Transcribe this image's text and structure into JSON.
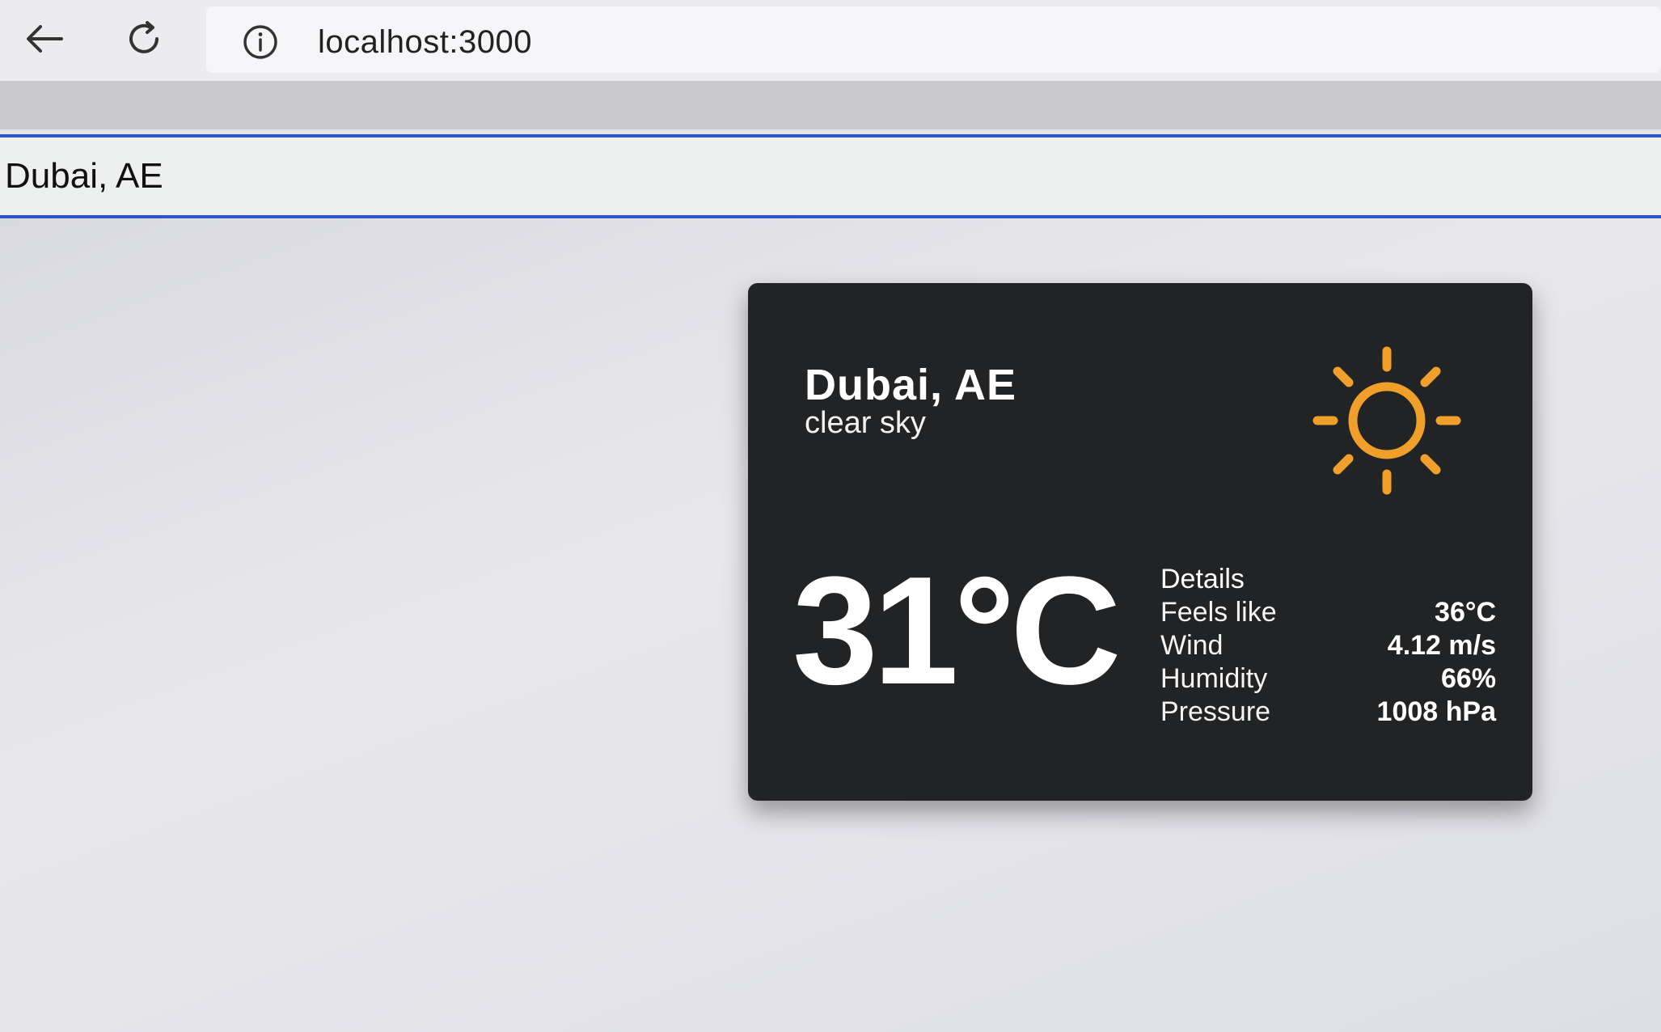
{
  "browser": {
    "url": "localhost:3000"
  },
  "search": {
    "value": "Dubai, AE"
  },
  "weather": {
    "city": "Dubai, AE",
    "description": "clear sky",
    "icon": "sun-icon",
    "temperature": "31°C",
    "details_header": "Details",
    "details": [
      {
        "label": "Feels like",
        "value": "36°C"
      },
      {
        "label": "Wind",
        "value": "4.12 m/s"
      },
      {
        "label": "Humidity",
        "value": "66%"
      },
      {
        "label": "Pressure",
        "value": "1008 hPa"
      }
    ],
    "colors": {
      "card_bg": "#222324",
      "sun": "#f0a02a",
      "search_border": "#2f56c8"
    }
  }
}
